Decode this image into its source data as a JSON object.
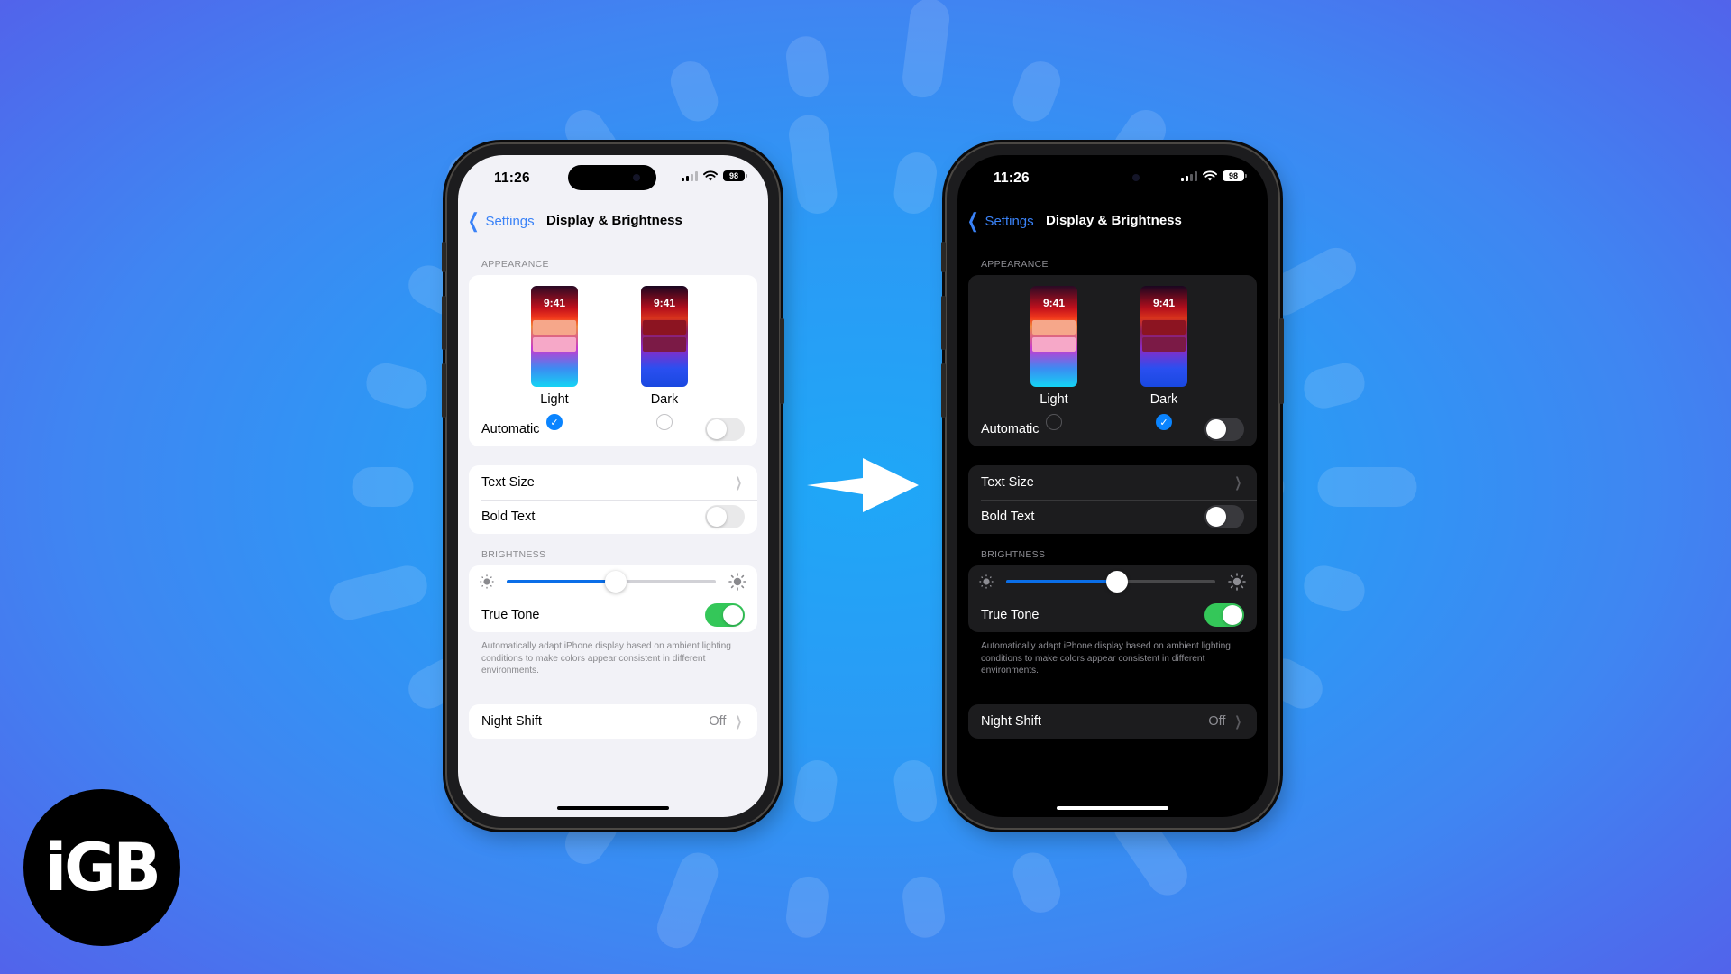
{
  "colors": {
    "accent": "#0a84ff",
    "link": "#3a82f7",
    "toggle_on": "#34c759",
    "slider_fill": "#0a6ee8",
    "background_center": "#1fa7f7",
    "background_edge": "#5361ea"
  },
  "arrow": {
    "icon": "right-arrow-icon"
  },
  "logo": {
    "text": "iGB"
  },
  "phones": [
    {
      "theme": "light",
      "status": {
        "time": "11:26",
        "battery": "98",
        "signal_bars": 2,
        "wifi": true
      },
      "nav": {
        "back_label": "Settings",
        "back_icon": "chevron-left-icon",
        "title": "Display & Brightness"
      },
      "appearance": {
        "header": "APPEARANCE",
        "options": [
          {
            "label": "Light",
            "preview_time": "9:41",
            "selected": true
          },
          {
            "label": "Dark",
            "preview_time": "9:41",
            "selected": false
          }
        ],
        "automatic": {
          "label": "Automatic",
          "on": false
        }
      },
      "text_group": {
        "text_size": {
          "label": "Text Size",
          "icon": "chevron-right-icon"
        },
        "bold_text": {
          "label": "Bold Text",
          "on": false
        }
      },
      "brightness": {
        "header": "BRIGHTNESS",
        "level": 0.52,
        "min_icon": "sun-small-icon",
        "max_icon": "sun-large-icon",
        "true_tone": {
          "label": "True Tone",
          "on": true
        },
        "footnote": "Automatically adapt iPhone display based on ambient lighting conditions to make colors appear consistent in different environments."
      },
      "night_shift": {
        "label": "Night Shift",
        "value": "Off",
        "icon": "chevron-right-icon"
      }
    },
    {
      "theme": "dark",
      "status": {
        "time": "11:26",
        "battery": "98",
        "signal_bars": 2,
        "wifi": true
      },
      "nav": {
        "back_label": "Settings",
        "back_icon": "chevron-left-icon",
        "title": "Display & Brightness"
      },
      "appearance": {
        "header": "APPEARANCE",
        "options": [
          {
            "label": "Light",
            "preview_time": "9:41",
            "selected": false
          },
          {
            "label": "Dark",
            "preview_time": "9:41",
            "selected": true
          }
        ],
        "automatic": {
          "label": "Automatic",
          "on": false
        }
      },
      "text_group": {
        "text_size": {
          "label": "Text Size",
          "icon": "chevron-right-icon"
        },
        "bold_text": {
          "label": "Bold Text",
          "on": false
        }
      },
      "brightness": {
        "header": "BRIGHTNESS",
        "level": 0.53,
        "min_icon": "sun-small-icon",
        "max_icon": "sun-large-icon",
        "true_tone": {
          "label": "True Tone",
          "on": true
        },
        "footnote": "Automatically adapt iPhone display based on ambient lighting conditions to make colors appear consistent in different environments."
      },
      "night_shift": {
        "label": "Night Shift",
        "value": "Off",
        "icon": "chevron-right-icon"
      }
    }
  ]
}
